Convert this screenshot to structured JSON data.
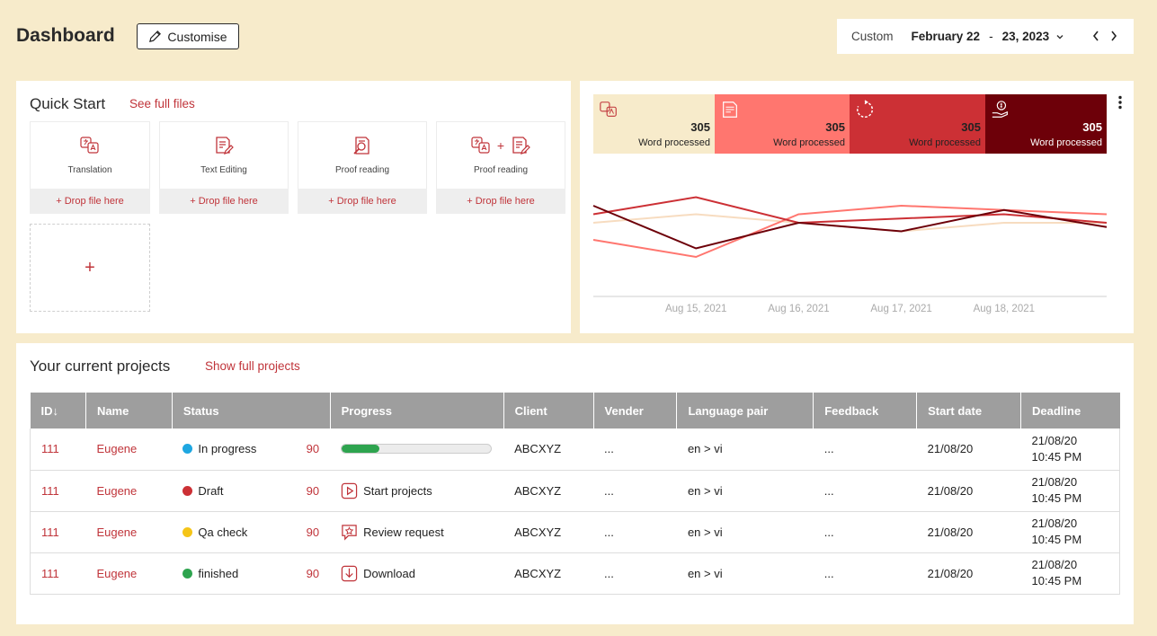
{
  "header": {
    "title": "Dashboard",
    "customise_label": "Customise",
    "date_mode": "Custom",
    "date_start": "February 22",
    "date_sep": "-",
    "date_end": "23, 2023",
    "chevron_down": "⌄",
    "prev": "‹",
    "next": "›"
  },
  "quick_start": {
    "title": "Quick Start",
    "link": "See full files",
    "drop_label": "+ Drop file here",
    "add_label": "+",
    "cards": [
      {
        "name": "Translation",
        "icon": "translation-icon"
      },
      {
        "name": "Text Editing",
        "icon": "text-editing-icon"
      },
      {
        "name": "Proof reading",
        "icon": "proof-reading-icon"
      },
      {
        "name": "Proof reading",
        "icon": "translation-plus-editing-icon",
        "plus": "+"
      }
    ]
  },
  "stats": [
    {
      "value": "305",
      "caption": "Word processed",
      "color": "#f7ebcb",
      "text": "#222",
      "icon": "translation-icon"
    },
    {
      "value": "305",
      "caption": "Word processed",
      "color": "#ff766f",
      "text": "#222",
      "icon": "document-icon"
    },
    {
      "value": "305",
      "caption": "Word processed",
      "color": "#cc3035",
      "text": "#222",
      "icon": "refresh-icon"
    },
    {
      "value": "305",
      "caption": "Word processed",
      "color": "#6d0009",
      "text": "#fff",
      "icon": "money-hand-icon"
    }
  ],
  "chart_data": {
    "type": "line",
    "categories": [
      "Aug 15, 2021",
      "Aug 16, 2021",
      "Aug 17, 2021",
      "Aug 18, 2021"
    ],
    "x_points": 6,
    "series": [
      {
        "color": "#f7dcc0",
        "values": [
          6,
          7,
          6,
          5,
          6,
          6
        ]
      },
      {
        "color": "#ff766f",
        "values": [
          4,
          2,
          7,
          8,
          7.5,
          7
        ]
      },
      {
        "color": "#cc3035",
        "values": [
          7,
          9,
          6,
          6.5,
          7,
          6
        ]
      },
      {
        "color": "#6d0009",
        "values": [
          8,
          3,
          6,
          5,
          7.5,
          5.5
        ]
      }
    ],
    "ylim": [
      0,
      10
    ]
  },
  "projects": {
    "title": "Your current projects",
    "link": "Show full projects",
    "columns": [
      "ID",
      "Name",
      "Status",
      "Progress",
      "Client",
      "Vender",
      "Language pair",
      "Feedback",
      "Start date",
      "Deadline"
    ],
    "sort_arrow": "↓",
    "rows": [
      {
        "id": "111",
        "name": "Eugene",
        "status": "In progress",
        "dot": "#1ea7e1",
        "score": "90",
        "progress_kind": "bar",
        "progress": 0.25,
        "client": "ABCXYZ",
        "vender": "...",
        "lang": "en > vi",
        "feedback": "...",
        "start": "21/08/20",
        "deadline_date": "21/08/20",
        "deadline_time": "10:45 PM"
      },
      {
        "id": "111",
        "name": "Eugene",
        "status": "Draft",
        "dot": "#cc3035",
        "score": "90",
        "progress_kind": "action",
        "action": "Start projects",
        "action_icon": "play-icon",
        "client": "ABCXYZ",
        "vender": "...",
        "lang": "en > vi",
        "feedback": "...",
        "start": "21/08/20",
        "deadline_date": "21/08/20",
        "deadline_time": "10:45 PM"
      },
      {
        "id": "111",
        "name": "Eugene",
        "status": "Qa check",
        "dot": "#f5c518",
        "score": "90",
        "progress_kind": "action",
        "action": "Review request",
        "action_icon": "review-icon",
        "client": "ABCXYZ",
        "vender": "...",
        "lang": "en > vi",
        "feedback": "...",
        "start": "21/08/20",
        "deadline_date": "21/08/20",
        "deadline_time": "10:45 PM"
      },
      {
        "id": "111",
        "name": "Eugene",
        "status": "finished",
        "dot": "#2ea44f",
        "score": "90",
        "progress_kind": "action",
        "action": "Download",
        "action_icon": "download-icon",
        "client": "ABCXYZ",
        "vender": "...",
        "lang": "en > vi",
        "feedback": "...",
        "start": "21/08/20",
        "deadline_date": "21/08/20",
        "deadline_time": "10:45 PM"
      }
    ]
  }
}
